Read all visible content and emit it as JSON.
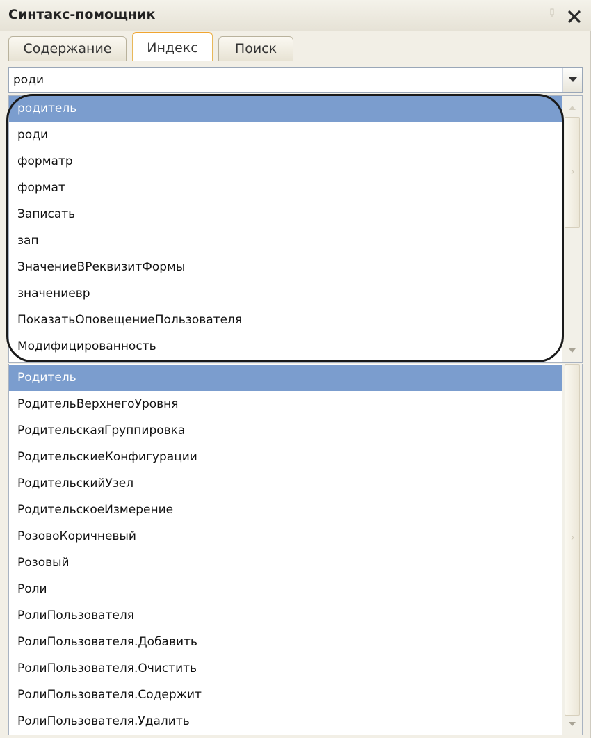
{
  "window": {
    "title": "Синтакс-помощник"
  },
  "tabs": [
    "Содержание",
    "Индекс",
    "Поиск"
  ],
  "active_tab": "Индекс",
  "search": {
    "value": "роди"
  },
  "suggestions": [
    "родитель",
    "роди",
    "форматр",
    "формат",
    "Записать",
    "зап",
    "ЗначениеВРеквизитФормы",
    "значениевр",
    "ПоказатьОповещениеПользователя",
    "Модифицированность"
  ],
  "results": [
    "Родитель",
    "РодительВерхнегоУровня",
    "РодительскаяГруппировка",
    "РодительскиеКонфигурации",
    "РодительскийУзел",
    "РодительскоеИзмерение",
    "РозовоКоричневый",
    "Розовый",
    "Роли",
    "РолиПользователя",
    "РолиПользователя.Добавить",
    "РолиПользователя.Очистить",
    "РолиПользователя.Содержит",
    "РолиПользователя.Удалить"
  ],
  "selected_suggestion": 0,
  "selected_result": 0,
  "colors": {
    "selection": "#7b9dce",
    "highlight_ring": "#1a1a1a",
    "active_tab_accent": "#f0a530"
  }
}
